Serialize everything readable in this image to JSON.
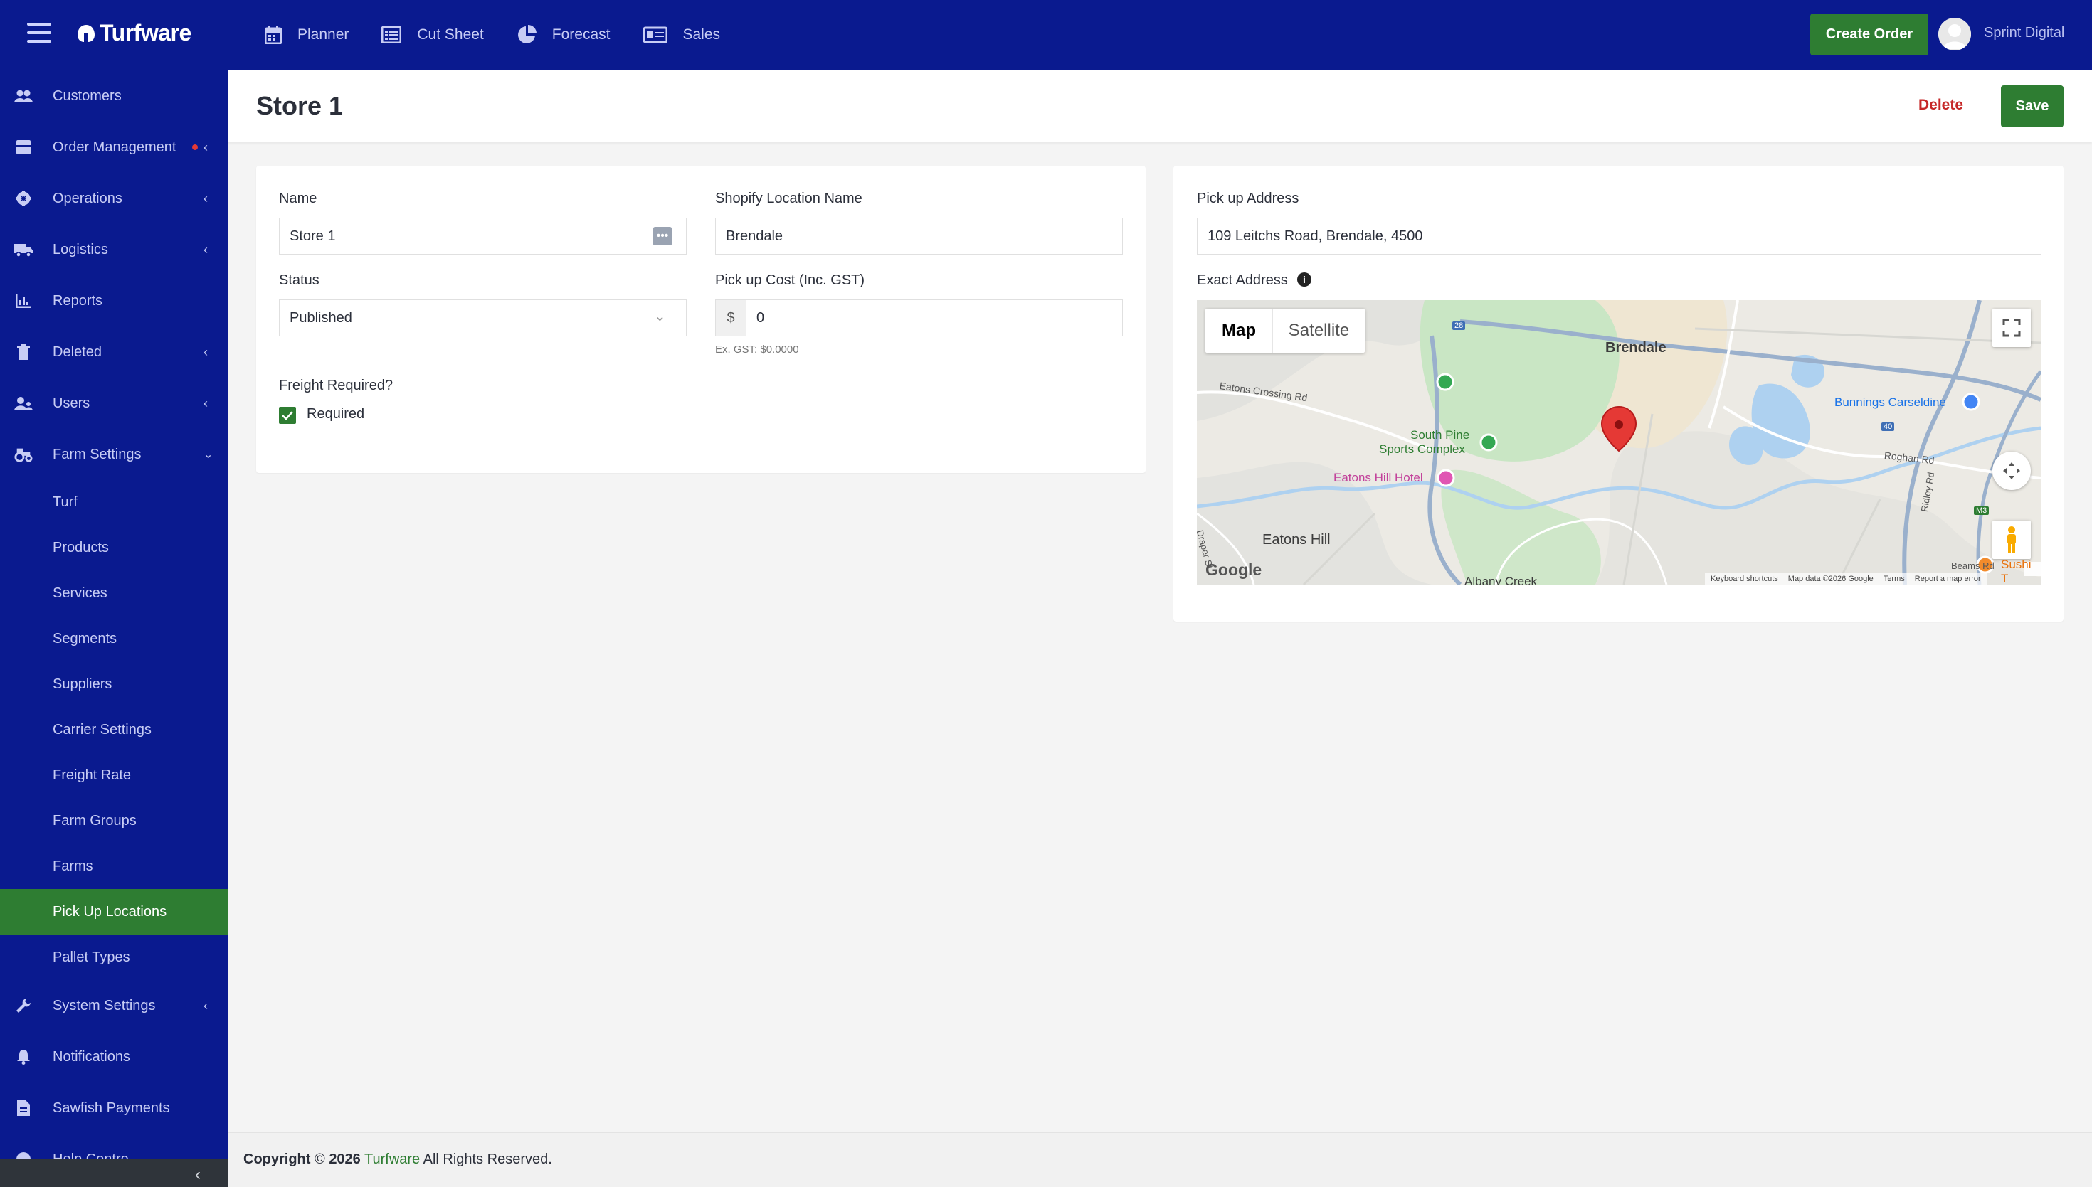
{
  "app": {
    "brand": "Turfware"
  },
  "topnav": [
    {
      "label": "Planner",
      "icon": "calendar-icon"
    },
    {
      "label": "Cut Sheet",
      "icon": "list-icon"
    },
    {
      "label": "Forecast",
      "icon": "pie-chart-icon"
    },
    {
      "label": "Sales",
      "icon": "money-icon"
    }
  ],
  "header_actions": {
    "create_order": "Create Order",
    "user_name": "Sprint Digital"
  },
  "sidebar": {
    "items": [
      {
        "label": "Customers",
        "icon": "users-icon"
      },
      {
        "label": "Order Management",
        "icon": "box-icon"
      },
      {
        "label": "Operations",
        "icon": "gear-icon"
      },
      {
        "label": "Logistics",
        "icon": "truck-icon"
      },
      {
        "label": "Reports",
        "icon": "bar-chart-icon"
      },
      {
        "label": "Deleted",
        "icon": "trash-icon"
      },
      {
        "label": "Users",
        "icon": "user-group-icon"
      },
      {
        "label": "Farm Settings",
        "icon": "tractor-icon"
      }
    ],
    "farm_settings": [
      "Turf",
      "Products",
      "Services",
      "Segments",
      "Suppliers",
      "Carrier Settings",
      "Freight Rate",
      "Farm Groups",
      "Farms",
      "Pick Up Locations",
      "Pallet Types"
    ],
    "active": "Pick Up Locations",
    "bottom_items": [
      {
        "label": "System Settings",
        "icon": "wrench-icon"
      },
      {
        "label": "Notifications",
        "icon": "bell-icon"
      },
      {
        "label": "Sawfish Payments",
        "icon": "document-icon"
      },
      {
        "label": "Help Centre",
        "icon": "help-icon"
      }
    ]
  },
  "page": {
    "title": "Store 1",
    "delete_label": "Delete",
    "save_label": "Save"
  },
  "form": {
    "name_label": "Name",
    "name_value": "Store 1",
    "shopify_label": "Shopify Location Name",
    "shopify_value": "Brendale",
    "status_label": "Status",
    "status_value": "Published",
    "pickup_cost_label": "Pick up Cost (Inc. GST)",
    "currency_symbol": "$",
    "pickup_cost_value": "0",
    "ex_gst_hint": "Ex. GST: $0.0000",
    "freight_label": "Freight Required?",
    "freight_checkbox_label": "Required",
    "freight_checked": true
  },
  "address": {
    "pickup_label": "Pick up Address",
    "pickup_value": "109 Leitchs Road, Brendale, 4500",
    "exact_label": "Exact Address"
  },
  "map": {
    "tab_map": "Map",
    "tab_satellite": "Satellite",
    "labels": {
      "brendale": "Brendale",
      "eatons_crossing": "Eatons Crossing Rd",
      "south_pine_1": "South Pine",
      "south_pine_2": "Sports Complex",
      "eatons_hill_hotel": "Eatons Hill Hotel",
      "eatons_hill": "Eatons Hill",
      "bunnings": "Bunnings Carseldine",
      "roghan_rd": "Roghan Rd",
      "ridley_rd": "Ridley Rd",
      "draper": "Draper St",
      "albany_creek": "Albany Creek",
      "beams": "Beams Rd",
      "sushi": "Sushi T",
      "route_28": "28",
      "route_40": "40",
      "route_m3": "M3"
    },
    "footer": {
      "google": "Google",
      "shortcuts": "Keyboard shortcuts",
      "map_data": "Map data ©2026 Google",
      "terms": "Terms",
      "report": "Report a map error"
    }
  },
  "footer": {
    "copyright": "Copyright",
    "symbol": "©",
    "year": "2026",
    "brand": "Turfware",
    "rights": "All Rights Reserved."
  },
  "colors": {
    "nav_bg": "#0a1a8f",
    "accent_green": "#2e7d32",
    "danger_red": "#c62828"
  }
}
